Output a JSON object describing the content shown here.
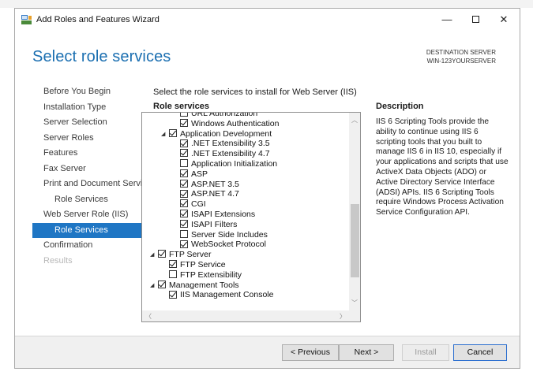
{
  "window": {
    "title": "Add Roles and Features Wizard",
    "minimize_glyph": "—",
    "close_glyph": "✕"
  },
  "header": {
    "page_title": "Select role services",
    "destination_label": "DESTINATION SERVER",
    "destination_server": "WIN-123YOURSERVER"
  },
  "nav": {
    "items": [
      {
        "label": "Before You Begin",
        "state": "normal"
      },
      {
        "label": "Installation Type",
        "state": "normal"
      },
      {
        "label": "Server Selection",
        "state": "normal"
      },
      {
        "label": "Server Roles",
        "state": "normal"
      },
      {
        "label": "Features",
        "state": "normal"
      },
      {
        "label": "Fax Server",
        "state": "normal"
      },
      {
        "label": "Print and Document Servi...",
        "state": "normal"
      },
      {
        "label": "Role Services",
        "state": "sub"
      },
      {
        "label": "Web Server Role (IIS)",
        "state": "normal"
      },
      {
        "label": "Role Services",
        "state": "active"
      },
      {
        "label": "Confirmation",
        "state": "normal"
      },
      {
        "label": "Results",
        "state": "disabled"
      }
    ]
  },
  "main": {
    "instruction": "Select the role services to install for Web Server (IIS)",
    "role_services_heading": "Role services",
    "description_heading": "Description",
    "description_text": "IIS 6 Scripting Tools provide the ability to continue using IIS 6 scripting tools that you built to manage IIS 6 in IIS 10, especially if your applications and scripts that use ActiveX Data Objects (ADO) or Active Directory Service Interface (ADSI) APIs. IIS 6 Scripting Tools require Windows Process Activation Service Configuration API."
  },
  "tree": {
    "expand_glyph": "◢",
    "items": [
      {
        "label": "URL Authorization",
        "level": 2,
        "checked": false,
        "expandable": false,
        "partial": true
      },
      {
        "label": "Windows Authentication",
        "level": 2,
        "checked": true,
        "expandable": false
      },
      {
        "label": "Application Development",
        "level": 1,
        "checked": true,
        "expandable": true
      },
      {
        "label": ".NET Extensibility 3.5",
        "level": 2,
        "checked": true,
        "expandable": false
      },
      {
        "label": ".NET Extensibility 4.7",
        "level": 2,
        "checked": true,
        "expandable": false
      },
      {
        "label": "Application Initialization",
        "level": 2,
        "checked": false,
        "expandable": false
      },
      {
        "label": "ASP",
        "level": 2,
        "checked": true,
        "expandable": false
      },
      {
        "label": "ASP.NET 3.5",
        "level": 2,
        "checked": true,
        "expandable": false
      },
      {
        "label": "ASP.NET 4.7",
        "level": 2,
        "checked": true,
        "expandable": false
      },
      {
        "label": "CGI",
        "level": 2,
        "checked": true,
        "expandable": false
      },
      {
        "label": "ISAPI Extensions",
        "level": 2,
        "checked": true,
        "expandable": false
      },
      {
        "label": "ISAPI Filters",
        "level": 2,
        "checked": true,
        "expandable": false
      },
      {
        "label": "Server Side Includes",
        "level": 2,
        "checked": false,
        "expandable": false
      },
      {
        "label": "WebSocket Protocol",
        "level": 2,
        "checked": true,
        "expandable": false
      },
      {
        "label": "FTP Server",
        "level": 0,
        "checked": true,
        "expandable": true
      },
      {
        "label": "FTP Service",
        "level": 1,
        "checked": true,
        "expandable": false
      },
      {
        "label": "FTP Extensibility",
        "level": 1,
        "checked": false,
        "expandable": false
      },
      {
        "label": "Management Tools",
        "level": 0,
        "checked": true,
        "expandable": true
      },
      {
        "label": "IIS Management Console",
        "level": 1,
        "checked": true,
        "expandable": false
      }
    ]
  },
  "scroll_glyphs": {
    "up": "︿",
    "down": "﹀",
    "left": "〈",
    "right": "〉"
  },
  "footer": {
    "previous_label": "< Previous",
    "next_label": "Next >",
    "install_label": "Install",
    "cancel_label": "Cancel"
  }
}
